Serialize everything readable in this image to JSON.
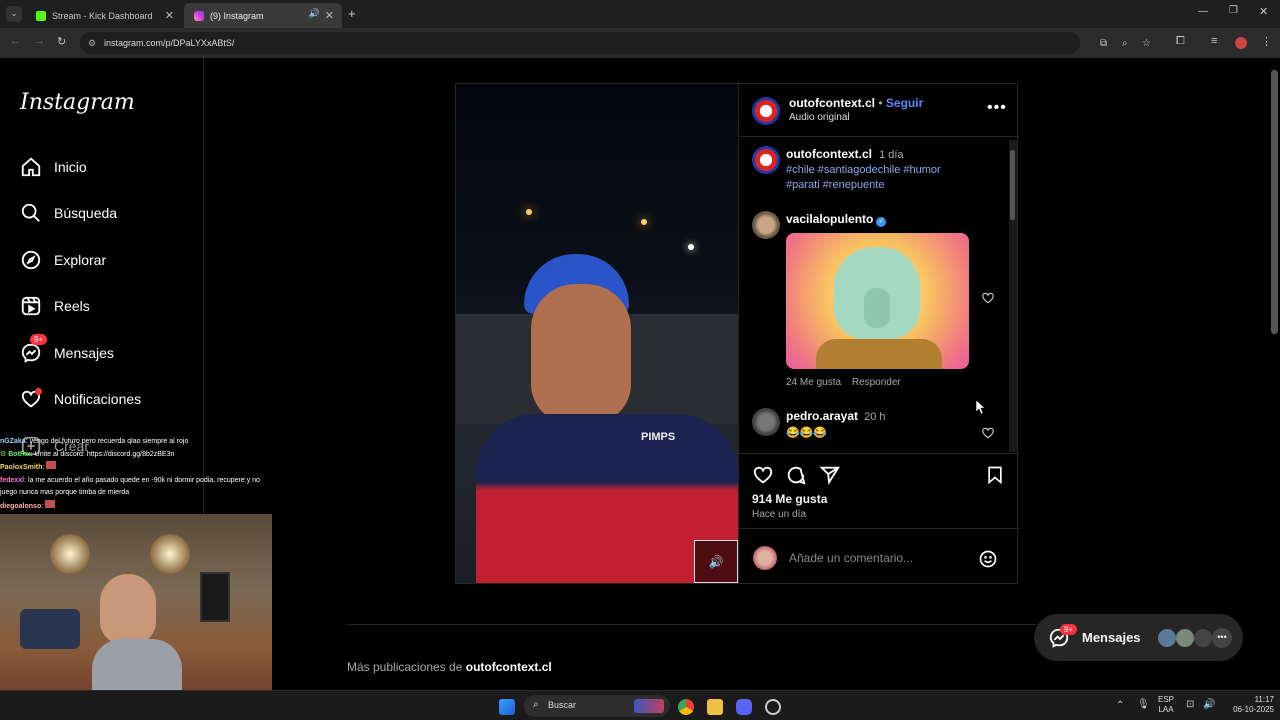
{
  "browser": {
    "tabs": [
      {
        "title": "Stream - Kick Dashboard",
        "icon": "kick-icon",
        "active": false
      },
      {
        "title": "(9) Instagram",
        "icon": "instagram-icon",
        "active": true
      }
    ],
    "url": "instagram.com/p/DPaLYXxABtS/"
  },
  "sidebar": {
    "logo": "Instagram",
    "items": [
      {
        "label": "Inicio",
        "icon": "home-icon"
      },
      {
        "label": "Búsqueda",
        "icon": "search-icon"
      },
      {
        "label": "Explorar",
        "icon": "compass-icon"
      },
      {
        "label": "Reels",
        "icon": "reels-icon"
      },
      {
        "label": "Mensajes",
        "icon": "messenger-icon",
        "badge": "9+"
      },
      {
        "label": "Notificaciones",
        "icon": "heart-icon"
      },
      {
        "label": "Crear",
        "icon": "plus-icon"
      }
    ]
  },
  "chat": [
    {
      "user": "nGZaka",
      "text": ": vengo del futuro pero recuerda qlao siempre al rojo",
      "color": "#9ad0ff"
    },
    {
      "user": "BotRix",
      "text": ": Unite al discord: https://discord.gg/8b2zBE3n",
      "color": "#6cf06c"
    },
    {
      "user": "PaoloxSmith",
      "text": ":",
      "color": "#f5d26a"
    },
    {
      "user": "fedexxl",
      "text": ": la me acuerdo el año pasado quede en -90k ni dormir podia, recupere y no juego nunca mas porque timba de mierda",
      "color": "#ff7bd0"
    },
    {
      "user": "diegoalonso",
      "text": ":",
      "color": "#ffb0a0"
    }
  ],
  "post": {
    "author": "outofcontext.cl",
    "follow": "Seguir",
    "separator": "•",
    "audio": "Audio original",
    "caption": {
      "user": "outofcontext.cl",
      "time": "1 día",
      "hashtags_line1": "#chile #santiagodechile #humor",
      "hashtags_line2": "#parati #renepuente"
    },
    "comments": [
      {
        "user": "vacilalopulento",
        "verified": true,
        "likes": "24 Me gusta",
        "reply": "Responder"
      },
      {
        "user": "pedro.arayat",
        "time": "20 h",
        "text": "😂😂😂"
      }
    ],
    "like_count": "914 Me gusta",
    "posted": "Hace un día",
    "comment_placeholder": "Añade un comentario..."
  },
  "more_posts": {
    "prefix": "Más publicaciones de",
    "user": "outofcontext.cl"
  },
  "messages_pill": {
    "label": "Mensajes",
    "badge": "9+"
  },
  "taskbar": {
    "search": "Buscar",
    "lang1": "ESP",
    "lang2": "LAA",
    "time": "11:17",
    "date": "06-10-2025"
  }
}
